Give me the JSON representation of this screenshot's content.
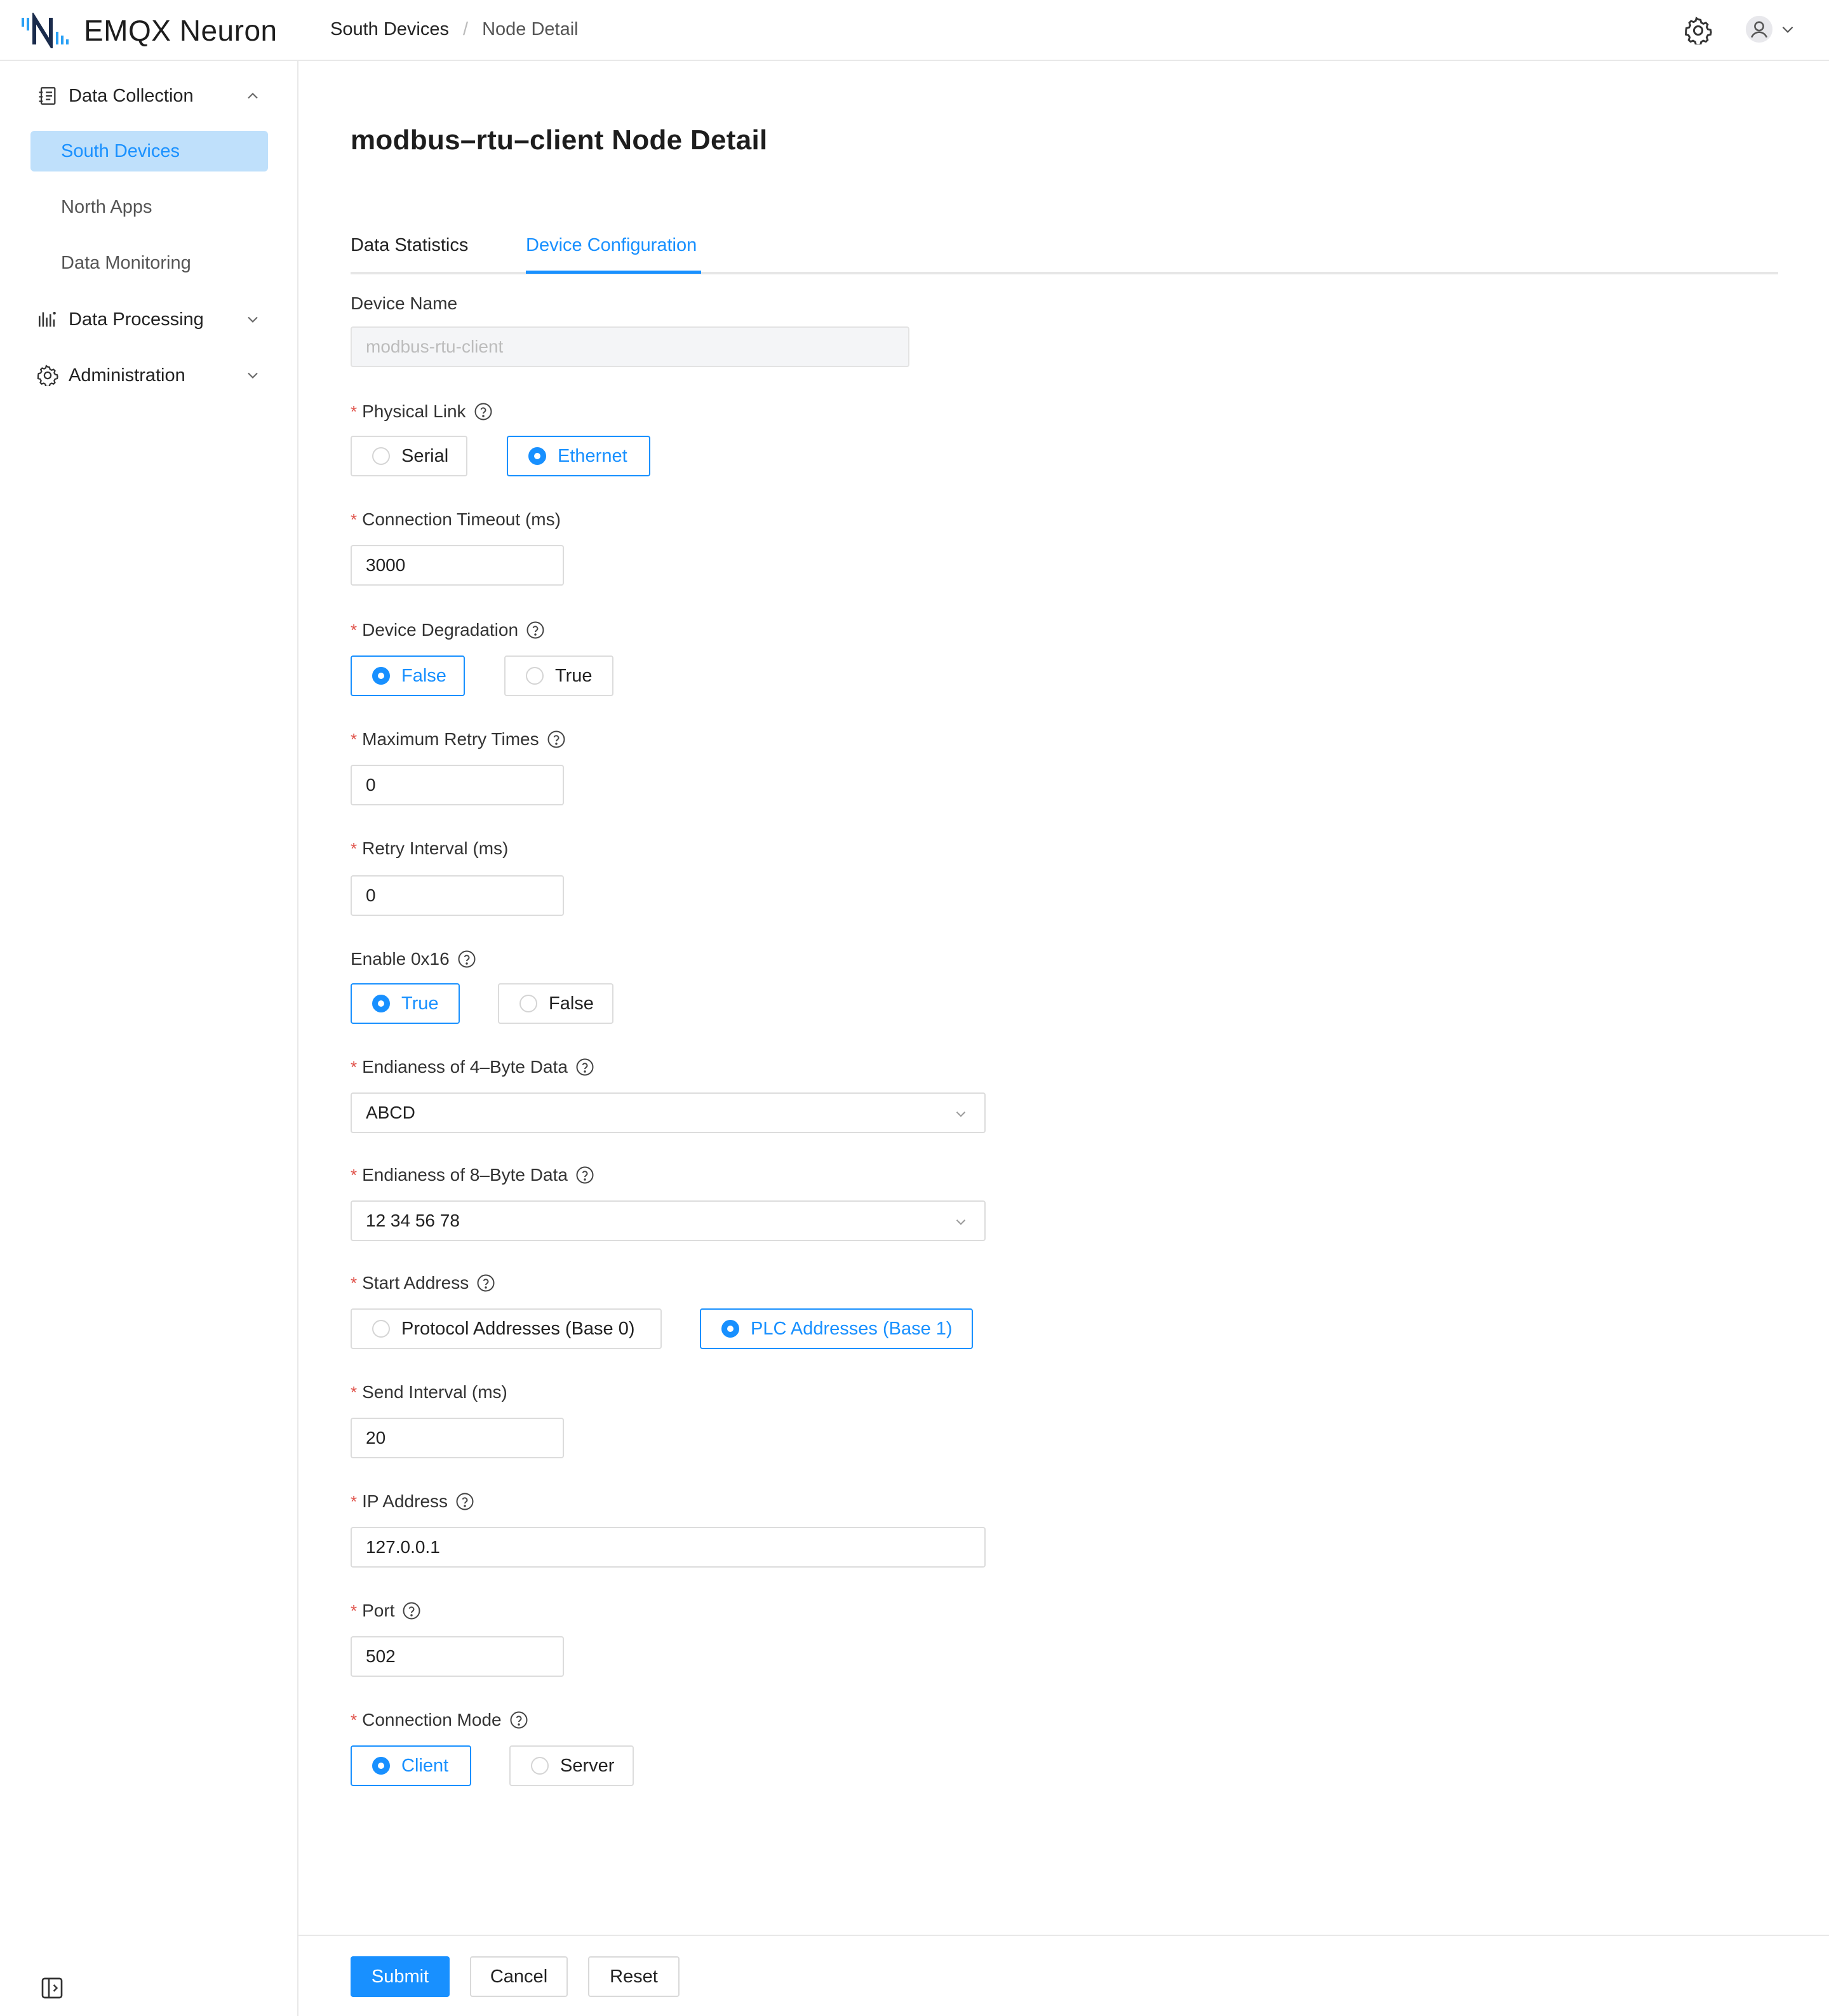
{
  "app": {
    "name": "EMQX Neuron"
  },
  "breadcrumb": {
    "parent": "South Devices",
    "separator": "/",
    "current": "Node Detail"
  },
  "header": {
    "settings_icon": "gear-icon",
    "user_icon": "user-avatar-icon"
  },
  "sidebar": {
    "groups": [
      {
        "label": "Data Collection",
        "icon": "data-collection-icon",
        "expanded": true
      },
      {
        "label": "Data Processing",
        "icon": "data-processing-icon",
        "expanded": false
      },
      {
        "label": "Administration",
        "icon": "administration-gear-icon",
        "expanded": false
      }
    ],
    "items": [
      {
        "label": "South Devices",
        "active": true
      },
      {
        "label": "North Apps",
        "active": false
      },
      {
        "label": "Data Monitoring",
        "active": false
      }
    ]
  },
  "page": {
    "title": "modbus–rtu–client Node Detail"
  },
  "tabs": [
    {
      "label": "Data Statistics",
      "active": false
    },
    {
      "label": "Device Configuration",
      "active": true
    }
  ],
  "form": {
    "device_name": {
      "label": "Device Name",
      "value": "modbus-rtu-client"
    },
    "physical_link": {
      "label": "Physical Link",
      "options": [
        "Serial",
        "Ethernet"
      ],
      "selected": "Ethernet"
    },
    "connection_timeout": {
      "label": "Connection Timeout (ms)",
      "value": "3000"
    },
    "device_degradation": {
      "label": "Device Degradation",
      "options": [
        "False",
        "True"
      ],
      "selected": "False"
    },
    "max_retry_times": {
      "label": "Maximum Retry Times",
      "value": "0"
    },
    "retry_interval": {
      "label": "Retry Interval (ms)",
      "value": "0"
    },
    "enable_0x16": {
      "label": "Enable 0x16",
      "options": [
        "True",
        "False"
      ],
      "selected": "True"
    },
    "endianess_4": {
      "label": "Endianess of 4–Byte Data",
      "value": "ABCD"
    },
    "endianess_8": {
      "label": "Endianess of 8–Byte Data",
      "value": "12 34 56 78"
    },
    "start_address": {
      "label": "Start Address",
      "options": [
        "Protocol Addresses (Base 0)",
        "PLC Addresses (Base 1)"
      ],
      "selected": "PLC Addresses (Base 1)"
    },
    "send_interval": {
      "label": "Send Interval (ms)",
      "value": "20"
    },
    "ip_address": {
      "label": "IP Address",
      "value": "127.0.0.1"
    },
    "port": {
      "label": "Port",
      "value": "502"
    },
    "connection_mode": {
      "label": "Connection Mode",
      "options": [
        "Client",
        "Server"
      ],
      "selected": "Client"
    }
  },
  "footer": {
    "submit": "Submit",
    "cancel": "Cancel",
    "reset": "Reset"
  },
  "colors": {
    "accent": "#1890ff",
    "active_bg": "#bfe0fb",
    "required": "#e0534b"
  }
}
